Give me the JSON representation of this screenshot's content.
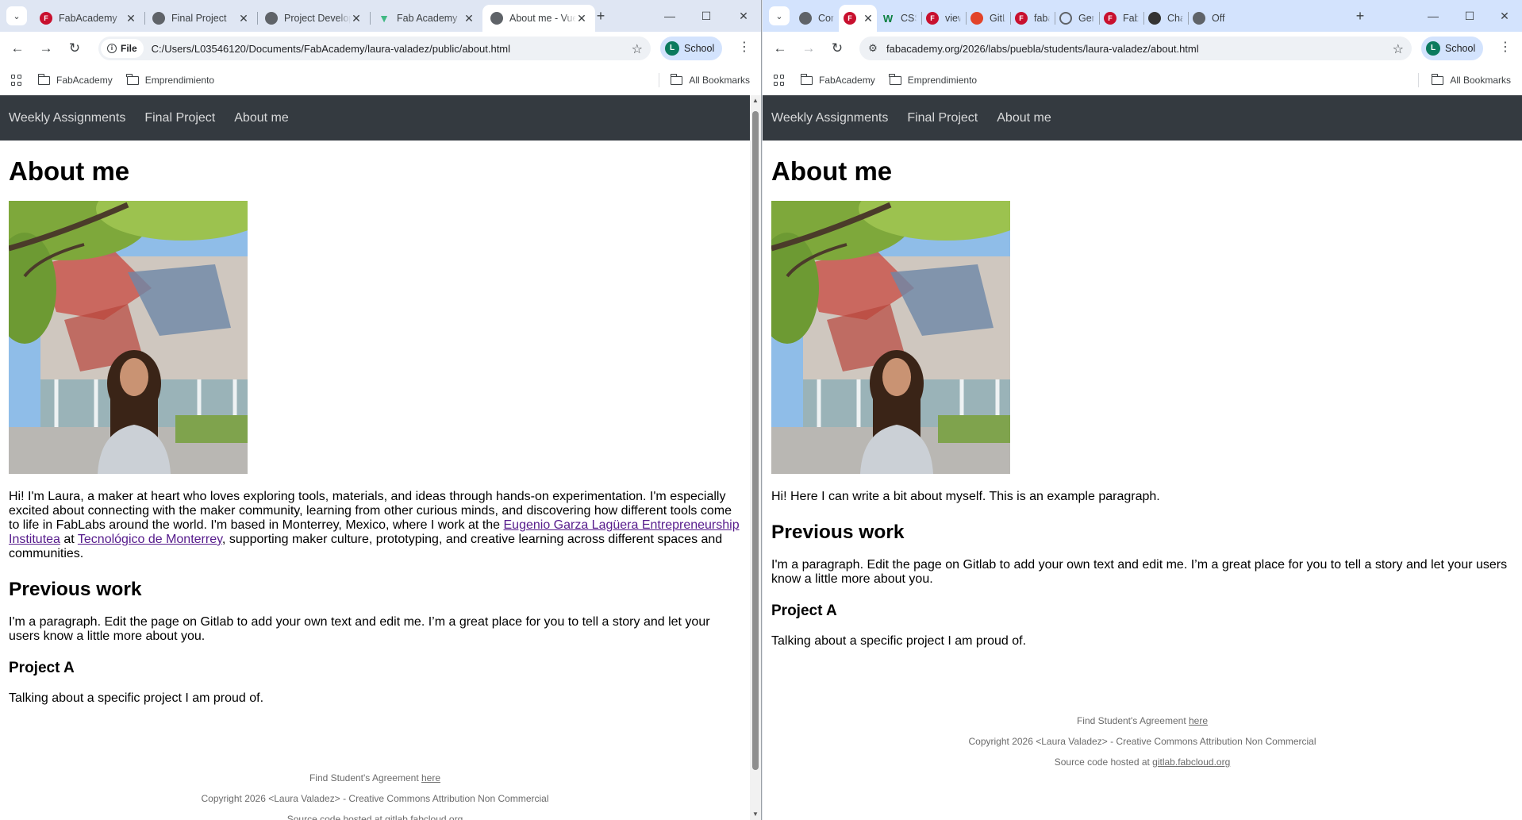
{
  "left": {
    "tabs": [
      {
        "title": "FabAcademy",
        "icon": "fabacademy-icon",
        "fav": "fav-fab",
        "glyph": "F"
      },
      {
        "title": "Final Project",
        "icon": "globe-icon",
        "fav": "fav-globe",
        "glyph": ""
      },
      {
        "title": "Project Development",
        "icon": "globe-icon",
        "fav": "fav-globe",
        "glyph": ""
      },
      {
        "title": "Fab Academy",
        "icon": "vue-icon",
        "fav": "fav-vue",
        "glyph": "▼"
      },
      {
        "title": "About me - Vue",
        "icon": "globe-icon",
        "fav": "fav-globe",
        "glyph": "",
        "active": true
      }
    ],
    "omnibox_chip": "File",
    "url": "C:/Users/L03546120/Documents/FabAcademy/laura-valadez/public/about.html",
    "profile_label": "School",
    "profile_initial": "L"
  },
  "right": {
    "tabs": [
      {
        "title": "Commits",
        "icon": "git-icon",
        "fav": "fav-globe",
        "glyph": ""
      },
      {
        "title": "",
        "icon": "fabacademy-icon",
        "fav": "fav-fab",
        "glyph": "F",
        "active": true
      },
      {
        "title": "CSS",
        "icon": "w3schools-icon",
        "fav": "fav-w",
        "glyph": "W"
      },
      {
        "title": "view",
        "icon": "fabacademy-icon",
        "fav": "fav-fab",
        "glyph": "F"
      },
      {
        "title": "GitLab",
        "icon": "gitlab-icon",
        "fav": "fav-git",
        "glyph": ""
      },
      {
        "title": "faba",
        "icon": "fabacademy-icon",
        "fav": "fav-fab",
        "glyph": "F"
      },
      {
        "title": "Gen",
        "icon": "generic-icon",
        "fav": "fav-gen",
        "glyph": ""
      },
      {
        "title": "Fab",
        "icon": "fabacademy-icon",
        "fav": "fav-fab",
        "glyph": "F"
      },
      {
        "title": "Chat",
        "icon": "chatgpt-icon",
        "fav": "fav-gpt",
        "glyph": ""
      },
      {
        "title": "Off",
        "icon": "globe-icon",
        "fav": "fav-globe",
        "glyph": ""
      }
    ],
    "url": "fabacademy.org/2026/labs/puebla/students/laura-valadez/about.html",
    "profile_label": "School",
    "profile_initial": "L"
  },
  "bookmarks": {
    "items": [
      "FabAcademy",
      "Emprendimiento"
    ],
    "all": "All Bookmarks"
  },
  "site": {
    "nav": [
      "Weekly Assignments",
      "Final Project",
      "About me"
    ],
    "title": "About me",
    "prev_title": "Previous work",
    "prev_text": "I'm a paragraph. Edit the page on Gitlab to add your own text and edit me. I’m a great place for you to tell a story and let your users know a little more about you.",
    "project_title": "Project A",
    "project_text": "Talking about a specific project I am proud of.",
    "footer": {
      "agreement": "Find Student's Agreement ",
      "agreement_link": "here",
      "copyright": "Copyright 2026 <Laura Valadez> - Creative Commons Attribution Non Commercial",
      "source": "Source code hosted at ",
      "source_link": "gitlab.fabcloud.org"
    }
  },
  "left_page": {
    "intro_a": "Hi! I'm Laura, a maker at heart who loves exploring tools, materials, and ideas through hands-on experimentation. I'm especially excited about connecting with the maker community, learning from other curious minds, and discovering how different tools come to life in FabLabs around the world. I'm based in Monterrey, Mexico, where I work at the ",
    "link1": "Eugenio Garza Lagüera Entrepreneurship Institutea",
    "intro_b": " at ",
    "link2": "Tecnológico de Monterrey",
    "intro_c": ", supporting maker culture, prototyping, and creative learning across different spaces and communities."
  },
  "right_page": {
    "intro": "Hi! Here I can write a bit about myself. This is an example paragraph."
  }
}
